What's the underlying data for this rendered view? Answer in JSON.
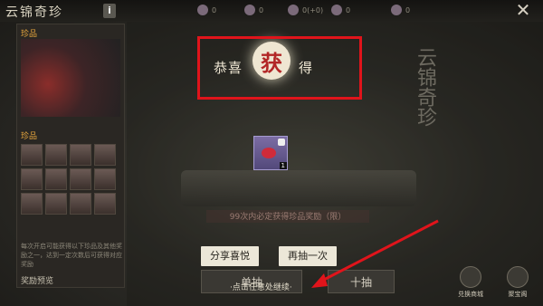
{
  "header": {
    "title": "云锦奇珍",
    "info_label": "i",
    "currencies": [
      "0",
      "0",
      "0(+0)",
      "0",
      "0"
    ],
    "close_label": "✕"
  },
  "left_panel": {
    "section1_title": "珍品",
    "section2_title": "珍品",
    "note": "每次开启可能获得以下珍品及其他奖励之一，达到一定次数后可获得对应奖励",
    "reward_preview": "奖励预览"
  },
  "result": {
    "title_left": "恭喜",
    "title_center": "获",
    "title_right": "得",
    "item_count": "1",
    "guarantee_text": "99次内必定获得珍品奖励（限）",
    "calligraphy": "云锦奇珍"
  },
  "actions": {
    "share": "分享喜悦",
    "again": "再抽一次",
    "single": "单抽",
    "ten": "十抽",
    "continue_hint": "·点击任意处继续·"
  },
  "side": {
    "exchange": "兑换商城",
    "treasure": "聚宝阁"
  },
  "colors": {
    "highlight": "#e0141b",
    "accent": "#e8a73d"
  }
}
